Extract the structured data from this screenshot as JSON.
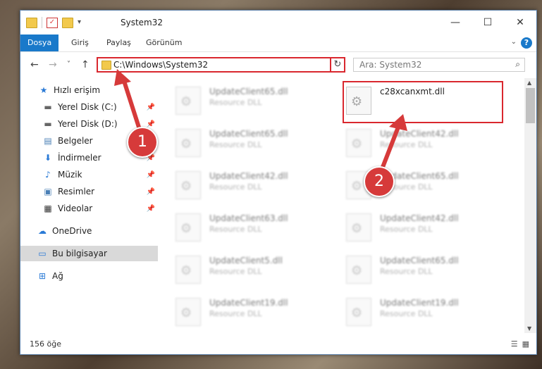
{
  "window": {
    "title": "System32",
    "controls": {
      "minimize": "—",
      "maximize": "☐",
      "close": "✕"
    }
  },
  "ribbon": {
    "tabs": [
      "Dosya",
      "Giriş",
      "Paylaş",
      "Görünüm"
    ],
    "help": "?"
  },
  "nav": {
    "back": "←",
    "forward": "→",
    "recent": "˅",
    "up": "↑",
    "address": "C:\\Windows\\System32",
    "refresh": "↻",
    "search_placeholder": "Ara: System32"
  },
  "sidebar": {
    "items": [
      {
        "label": "Hızlı erişim",
        "icon": "star-icon",
        "glyph": "★"
      },
      {
        "label": "Yerel Disk (C:)",
        "icon": "drive-icon",
        "glyph": "▬"
      },
      {
        "label": "Yerel Disk (D:)",
        "icon": "drive-icon",
        "glyph": "▬"
      },
      {
        "label": "Belgeler",
        "icon": "documents-icon",
        "glyph": "▤"
      },
      {
        "label": "İndirmeler",
        "icon": "download-icon",
        "glyph": "⬇"
      },
      {
        "label": "Müzik",
        "icon": "music-icon",
        "glyph": "♪"
      },
      {
        "label": "Resimler",
        "icon": "pictures-icon",
        "glyph": "▣"
      },
      {
        "label": "Videolar",
        "icon": "videos-icon",
        "glyph": "▦"
      },
      {
        "label": "OneDrive",
        "icon": "cloud-icon",
        "glyph": "☁"
      },
      {
        "label": "Bu bilgisayar",
        "icon": "computer-icon",
        "glyph": "▭"
      },
      {
        "label": "Ağ",
        "icon": "network-icon",
        "glyph": "⊞"
      }
    ],
    "pin": "📌"
  },
  "files": {
    "left": [
      {
        "name": "UpdateClient65.dll",
        "type": "Resource DLL"
      },
      {
        "name": "UpdateClient65.dll",
        "type": "Resource DLL"
      },
      {
        "name": "UpdateClient42.dll",
        "type": "Resource DLL"
      },
      {
        "name": "UpdateClient63.dll",
        "type": "Resource DLL"
      },
      {
        "name": "UpdateClient5.dll",
        "type": "Resource DLL"
      },
      {
        "name": "UpdateClient19.dll",
        "type": "Resource DLL"
      }
    ],
    "right": [
      {
        "name": "c28xcanxmt.dll",
        "type": ""
      },
      {
        "name": "UpdateClient42.dll",
        "type": "Resource DLL"
      },
      {
        "name": "UpdateClient65.dll",
        "type": "Resource DLL"
      },
      {
        "name": "UpdateClient42.dll",
        "type": "Resource DLL"
      },
      {
        "name": "UpdateClient65.dll",
        "type": "Resource DLL"
      },
      {
        "name": "UpdateClient19.dll",
        "type": "Resource DLL"
      }
    ]
  },
  "status": {
    "count": "156 öğe"
  },
  "callouts": {
    "one": "1",
    "two": "2"
  },
  "colors": {
    "accent": "#1979ca",
    "highlight": "#d9272e",
    "callout": "#d63a3a"
  }
}
